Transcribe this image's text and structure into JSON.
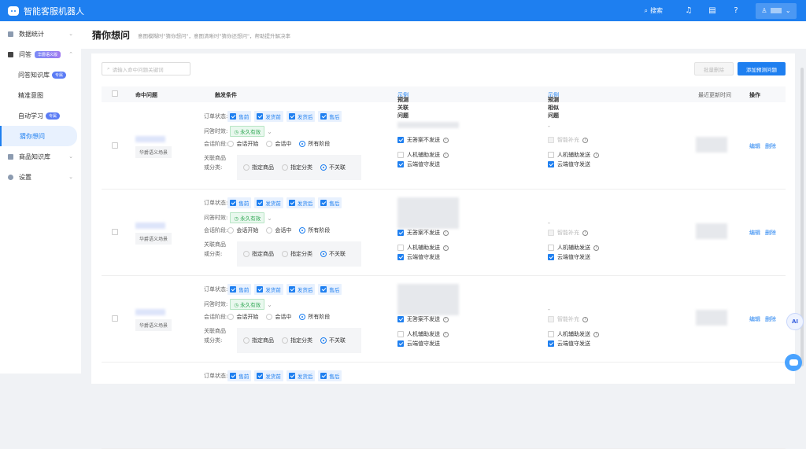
{
  "header": {
    "app_title": "智能客服机器人",
    "search_label": "搜索",
    "icons": [
      "bell-icon",
      "document-icon",
      "help-icon",
      "user-icon"
    ]
  },
  "sidebar": {
    "items": [
      {
        "label": "数据统计",
        "expanded": false
      },
      {
        "label": "问答",
        "badge": "华爵语义版",
        "expanded": true,
        "children": [
          {
            "label": "问答知识库",
            "badge": "专属"
          },
          {
            "label": "精准意图"
          },
          {
            "label": "自动学习",
            "badge": "专属"
          },
          {
            "label": "猜你想问",
            "active": true
          }
        ]
      },
      {
        "label": "商品知识库",
        "expanded": false
      },
      {
        "label": "设置",
        "expanded": false
      }
    ]
  },
  "page": {
    "title": "猜你想问",
    "description": "意图模糊时\"猜你想问\"，意图清晰时\"猜你还想问\"，帮助提升解决率"
  },
  "toolbar": {
    "search_placeholder": "请输入命中问题关键词",
    "batch_delete": "批量删除",
    "add": "添加预测问题"
  },
  "table": {
    "columns": {
      "hit": "命中问题",
      "trigger": "触发条件",
      "related": "预测关联问题",
      "related_link": "示例",
      "similar": "预测相似问题",
      "similar_link": "示例",
      "updated": "最近更新时间",
      "ops": "操作"
    },
    "labels": {
      "order_status": "订单状态:",
      "validity": "问答时效:",
      "stage": "会话阶段:",
      "link_goods_1": "关联商品",
      "link_goods_2": "或分类:"
    },
    "order_tags": [
      "售前",
      "发货前",
      "发货后",
      "售后"
    ],
    "validity_value": "永久有效",
    "stage_options": [
      "会话开始",
      "会话中",
      "所有阶段"
    ],
    "link_options": [
      "指定商品",
      "指定分类",
      "不关联"
    ],
    "related_opts": [
      "无答案不发送",
      "人机辅助发送",
      "云端值守发送"
    ],
    "similar_opts": [
      "智能补充",
      "人机辅助发送",
      "云端值守发送"
    ],
    "similar_empty": "-",
    "edit": "编辑",
    "delete": "删除",
    "rows": [
      {
        "scene": "华爵语义场景",
        "stage": 2,
        "link": 2,
        "related_checked": [
          true,
          false,
          true
        ],
        "similar_checked": [
          false,
          false,
          true
        ]
      },
      {
        "scene": "华爵语义场景",
        "stage": 2,
        "link": 2,
        "related_checked": [
          true,
          false,
          true
        ],
        "similar_checked": [
          false,
          false,
          true
        ]
      },
      {
        "scene": "华爵语义场景",
        "stage": 2,
        "link": 2,
        "related_checked": [
          true,
          false,
          true
        ],
        "similar_checked": [
          false,
          false,
          true
        ]
      }
    ]
  },
  "ai_button": "AI"
}
